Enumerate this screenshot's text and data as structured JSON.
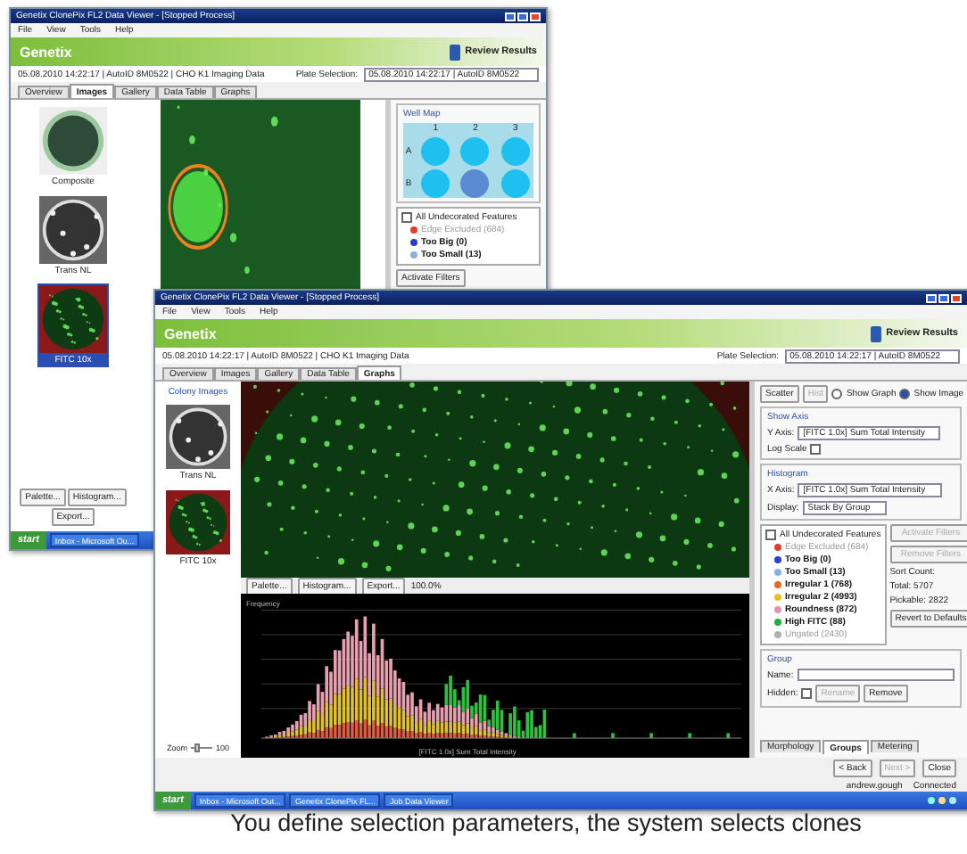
{
  "back_window": {
    "title": "Genetix ClonePix FL2 Data Viewer - [Stopped Process]",
    "menu": [
      "File",
      "View",
      "Tools",
      "Help"
    ],
    "brand": "Genetix",
    "review_button": "Review Results",
    "run_info": "05.08.2010 14:22:17 | AutoID 8M0522 | CHO K1 Imaging Data",
    "plate_label": "Plate Selection:",
    "plate_value": "05.08.2010 14:22:17 | AutoID 8M0522",
    "tabs": [
      {
        "label": "Overview",
        "selected": false
      },
      {
        "label": "Images",
        "selected": true
      },
      {
        "label": "Gallery",
        "selected": false
      },
      {
        "label": "Data Table",
        "selected": false
      },
      {
        "label": "Graphs",
        "selected": false
      }
    ],
    "thumbnails": [
      {
        "label": "Composite",
        "kind": "composite",
        "selected": false
      },
      {
        "label": "Trans NL",
        "kind": "brightfield",
        "selected": false
      },
      {
        "label": "FITC 10x",
        "kind": "fluorescence",
        "selected": true
      }
    ],
    "well_map": {
      "title": "Well Map",
      "columns": [
        "1",
        "2",
        "3"
      ],
      "rows": [
        {
          "label": "A",
          "wells": [
            {
              "selected": false
            },
            {
              "selected": false
            },
            {
              "selected": false
            }
          ]
        },
        {
          "label": "B",
          "wells": [
            {
              "selected": false
            },
            {
              "selected": true
            },
            {
              "selected": false
            }
          ]
        }
      ]
    },
    "legend_header": "All Undecorated Features",
    "legend_checked": false,
    "legend": [
      {
        "label": "Edge Excluded (684)",
        "color": "#e0402a",
        "disabled": true
      },
      {
        "label": "Too Big (0)",
        "color": "#2a3fd0",
        "disabled": false
      },
      {
        "label": "Too Small (13)",
        "color": "#8ab0e0",
        "disabled": false
      }
    ],
    "side_buttons": [
      "Activate Filters"
    ],
    "toolbar": [
      "Palette...",
      "Histogram...",
      "Export..."
    ],
    "taskbar": {
      "start": "start",
      "items": [
        "Inbox - Microsoft Ou..."
      ]
    }
  },
  "front_window": {
    "title": "Genetix ClonePix FL2 Data Viewer - [Stopped Process]",
    "menu": [
      "File",
      "View",
      "Tools",
      "Help"
    ],
    "brand": "Genetix",
    "review_button": "Review Results",
    "run_info": "05.08.2010 14:22:17 | AutoID 8M0522 | CHO K1 Imaging Data",
    "plate_label": "Plate Selection:",
    "plate_value": "05.08.2010 14:22:17 | AutoID 8M0522",
    "tabs": [
      {
        "label": "Overview",
        "selected": false
      },
      {
        "label": "Images",
        "selected": false
      },
      {
        "label": "Gallery",
        "selected": false
      },
      {
        "label": "Data Table",
        "selected": false
      },
      {
        "label": "Graphs",
        "selected": true
      }
    ],
    "images_title": "Colony Images",
    "thumbnails": [
      {
        "label": "Trans NL",
        "kind": "brightfield",
        "selected": false
      },
      {
        "label": "FITC 10x",
        "kind": "fluorescence",
        "selected": false
      }
    ],
    "zoom_label": "Zoom",
    "zoom_value": "100",
    "zoom_slider": {
      "level": 0.3
    },
    "image_toolbar": [
      "Palette...",
      "Histogram...",
      "Export..."
    ],
    "image_zoom_value": "100.0%",
    "chart": {
      "ylabel": "Frequency",
      "xlabel": "[FITC 1.0x] Sum Total Intensity"
    },
    "graph_modes": [
      {
        "label": "Scatter",
        "selected": true
      },
      {
        "label": "Hist",
        "selected": false
      }
    ],
    "view_options": [
      {
        "label": "Show Graph",
        "selected": false
      },
      {
        "label": "Show Image",
        "selected": true
      }
    ],
    "y_group": {
      "title": "Show Axis",
      "axis_label": "Y Axis:",
      "axis_value": "[FITC 1.0x] Sum Total Intensity",
      "log_label": "Log Scale",
      "log_checked": false
    },
    "x_group": {
      "title": "Histogram",
      "axis_label": "X Axis:",
      "axis_value": "[FITC 1.0x] Sum Total Intensity",
      "display_label": "Display:",
      "display_value": "Stack By Group"
    },
    "legend_header": "All Undecorated Features",
    "legend_checked": false,
    "legend": [
      {
        "label": "Edge Excluded (684)",
        "color": "#e0402a",
        "disabled": true
      },
      {
        "label": "Too Big (0)",
        "color": "#2a3fd0",
        "disabled": false
      },
      {
        "label": "Too Small (13)",
        "color": "#8ab0e0",
        "disabled": false
      },
      {
        "label": "Irregular 1 (768)",
        "color": "#e06a20",
        "disabled": false
      },
      {
        "label": "Irregular 2 (4993)",
        "color": "#e8c020",
        "disabled": false
      },
      {
        "label": "Roundness (872)",
        "color": "#e890b0",
        "disabled": false
      },
      {
        "label": "High FITC (88)",
        "color": "#20b040",
        "disabled": false
      },
      {
        "label": "Ungated (2430)",
        "color": "#b0b0b0",
        "disabled": true
      }
    ],
    "filter_buttons": [
      {
        "label": "Activate Filters",
        "disabled": true
      },
      {
        "label": "Remove Filters",
        "disabled": true
      }
    ],
    "counts": [
      "Sort Count:",
      "Total: 5707",
      "Pickable: 2822"
    ],
    "revert_button": "Revert to Defaults",
    "group": {
      "title": "Group",
      "name_label": "Name:",
      "hidden_label": "Hidden:",
      "hidden_checked": false,
      "rename_button": "Rename",
      "remove_button": "Remove"
    },
    "bottom_tabs": [
      {
        "label": "Morphology",
        "selected": false
      },
      {
        "label": "Groups",
        "selected": true
      },
      {
        "label": "Metering",
        "selected": false
      }
    ],
    "buttons": [
      {
        "label": "< Back",
        "disabled": false
      },
      {
        "label": "Next >",
        "disabled": true
      },
      {
        "label": "Close",
        "disabled": false
      }
    ],
    "status": [
      "andrew.gough",
      "Connected"
    ],
    "taskbar": {
      "start": "start",
      "items": [
        "Inbox - Microsoft Out...",
        "Genetix ClonePix FL...",
        "Job Data Viewer"
      ]
    }
  },
  "caption": "You define selection parameters, the system selects clones"
}
